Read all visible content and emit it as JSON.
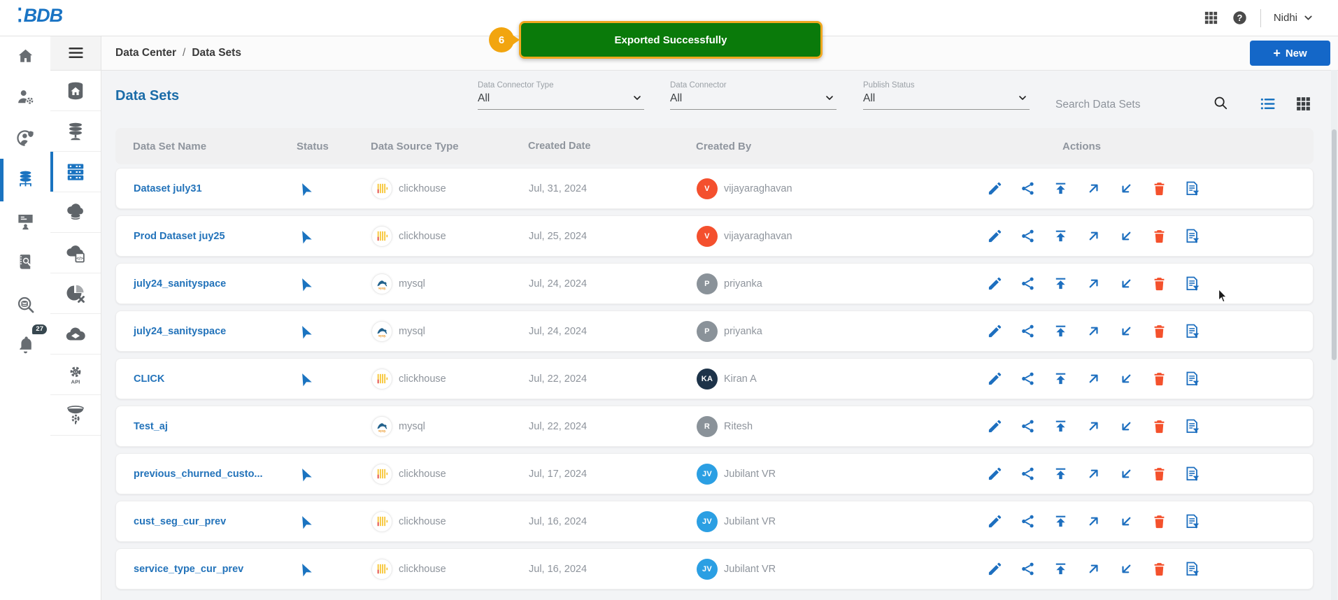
{
  "topbar": {
    "logo_text": "BDB",
    "user_name": "Nidhi"
  },
  "toast": {
    "step": "6",
    "message": "Exported Successfully",
    "bg_color": "#0a7a0a",
    "border_color": "#f0a71f"
  },
  "nav": {
    "breadcrumb": [
      "Data Center",
      "Data Sets"
    ],
    "separator": "/"
  },
  "page_actions": {
    "new_plus": "+",
    "new_label": "New"
  },
  "page": {
    "title": "Data Sets"
  },
  "filters": {
    "connector_type": {
      "label": "Data Connector Type",
      "value": "All"
    },
    "connector": {
      "label": "Data Connector",
      "value": "All"
    },
    "publish_status": {
      "label": "Publish Status",
      "value": "All"
    },
    "search_placeholder": "Search Data Sets"
  },
  "sidebar": {
    "notification_count": "27"
  },
  "colors": {
    "accent_blue": "#1a73c0",
    "link_blue": "#2373ba",
    "delete_red": "#f4512c",
    "title_blue": "#1b6ca8"
  },
  "table": {
    "headers": [
      "Data Set Name",
      "Status",
      "Data Source Type",
      "Created Date",
      "Created By",
      "Actions"
    ],
    "action_names": [
      "edit",
      "share",
      "publish",
      "push",
      "pull",
      "delete",
      "data-filter"
    ],
    "rows": [
      {
        "name": "Dataset july31",
        "published": true,
        "source_type": "clickhouse",
        "created": "Jul, 31, 2024",
        "creator": "vijayaraghavan",
        "initials": "V",
        "avatar_color": "#f4502e"
      },
      {
        "name": "Prod Dataset juy25",
        "published": true,
        "source_type": "clickhouse",
        "created": "Jul, 25, 2024",
        "creator": "vijayaraghavan",
        "initials": "V",
        "avatar_color": "#f4502e"
      },
      {
        "name": "july24_sanityspace",
        "published": true,
        "source_type": "mysql",
        "created": "Jul, 24, 2024",
        "creator": "priyanka",
        "initials": "P",
        "avatar_color": "#8a9299"
      },
      {
        "name": "july24_sanityspace",
        "published": true,
        "source_type": "mysql",
        "created": "Jul, 24, 2024",
        "creator": "priyanka",
        "initials": "P",
        "avatar_color": "#8a9299"
      },
      {
        "name": "CLICK",
        "published": true,
        "source_type": "clickhouse",
        "created": "Jul, 22, 2024",
        "creator": "Kiran A",
        "initials": "KA",
        "avatar_color": "#1d3349"
      },
      {
        "name": "Test_aj",
        "published": false,
        "source_type": "mysql",
        "created": "Jul, 22, 2024",
        "creator": "Ritesh",
        "initials": "R",
        "avatar_color": "#8a9299"
      },
      {
        "name": "previous_churned_custo...",
        "published": true,
        "source_type": "clickhouse",
        "created": "Jul, 17, 2024",
        "creator": "Jubilant VR",
        "initials": "JV",
        "avatar_color": "#2b9fe3"
      },
      {
        "name": "cust_seg_cur_prev",
        "published": true,
        "source_type": "clickhouse",
        "created": "Jul, 16, 2024",
        "creator": "Jubilant VR",
        "initials": "JV",
        "avatar_color": "#2b9fe3"
      },
      {
        "name": "service_type_cur_prev",
        "published": true,
        "source_type": "clickhouse",
        "created": "Jul, 16, 2024",
        "creator": "Jubilant VR",
        "initials": "JV",
        "avatar_color": "#2b9fe3"
      }
    ]
  }
}
